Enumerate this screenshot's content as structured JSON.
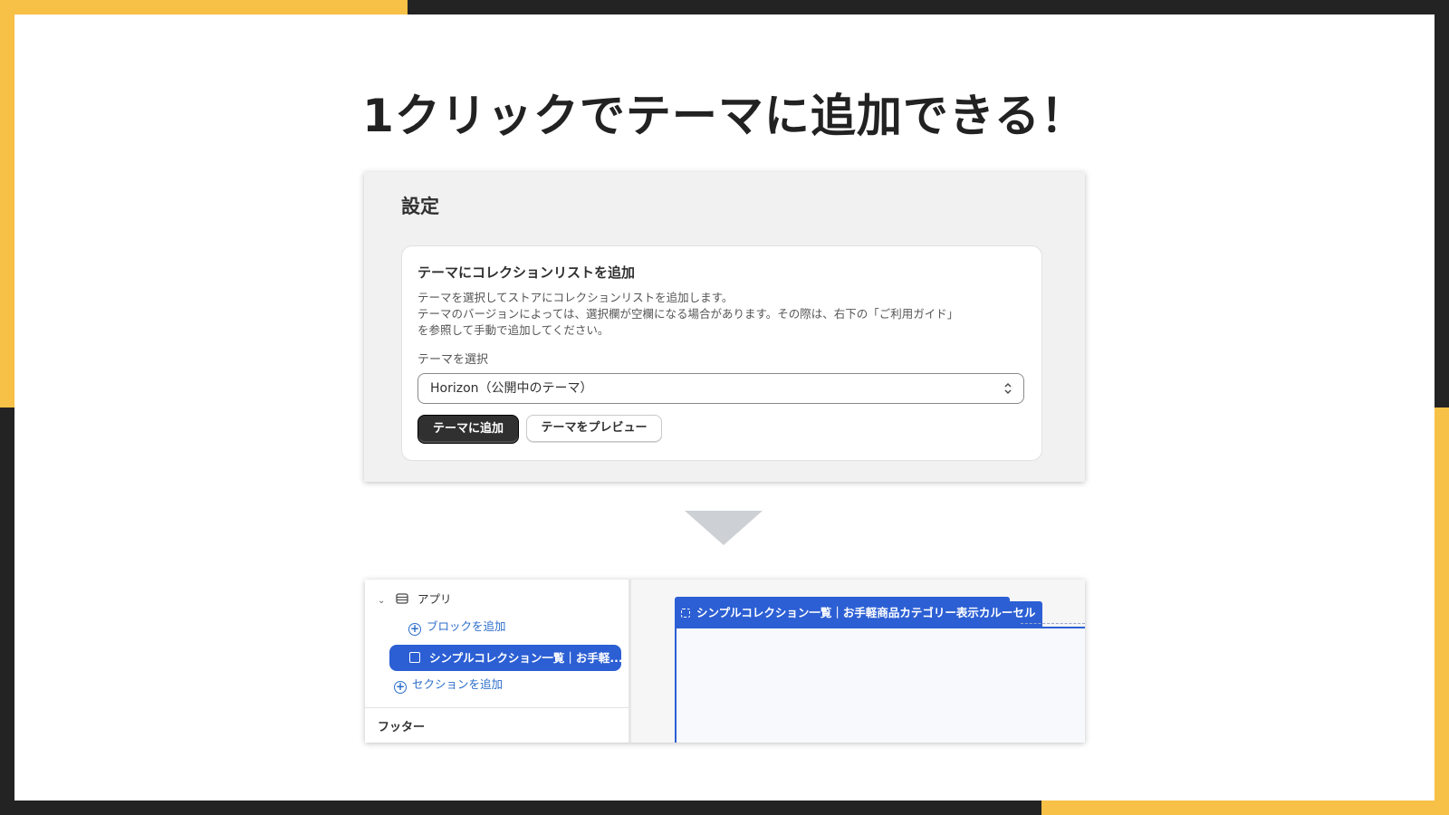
{
  "slide": {
    "title": "1クリックでテーマに追加できる！",
    "colors": {
      "accent": "#f7c046",
      "frame": "#232323",
      "primary_blue": "#2c5fd4"
    }
  },
  "settings": {
    "heading": "設定",
    "card": {
      "title": "テーマにコレクションリストを追加",
      "description_lines": [
        "テーマを選択してストアにコレクションリストを追加します。",
        "テーマのバージョンによっては、選択欄が空欄になる場合があります。その際は、右下の「ご利用ガイド」",
        "を参照して手動で追加してください。"
      ],
      "select_label": "テーマを選択",
      "select_value": "Horizon（公開中のテーマ）",
      "add_button": "テーマに追加",
      "preview_button": "テーマをプレビュー"
    }
  },
  "editor": {
    "sidebar": {
      "apps_label": "アプリ",
      "add_block": "ブロックを追加",
      "selected_block": "シンプルコレクション一覧｜お手軽...",
      "add_section": "セクションを追加",
      "footer": "フッター"
    },
    "canvas": {
      "block_tab": "シンプルコレクション一覧｜お手軽商品カテゴリー表示カルーセル"
    }
  }
}
